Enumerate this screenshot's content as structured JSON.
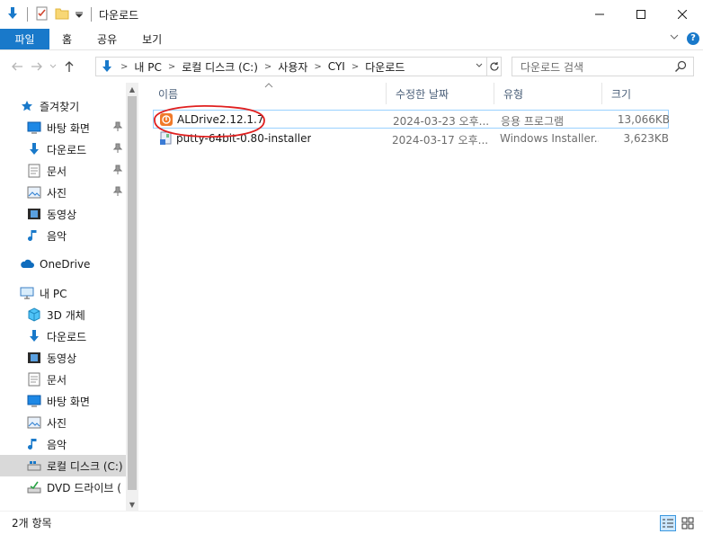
{
  "window": {
    "title": "다운로드"
  },
  "ribbon": {
    "tabs": [
      "파일",
      "홈",
      "공유",
      "보기"
    ]
  },
  "address": {
    "crumbs": [
      "내 PC",
      "로컬 디스크 (C:)",
      "사용자",
      "CYI",
      "다운로드"
    ],
    "search_placeholder": "다운로드 검색"
  },
  "sidebar": {
    "items": [
      {
        "label": "즐겨찾기",
        "icon": "star-icon",
        "pinned": false
      },
      {
        "label": "바탕 화면",
        "icon": "desktop-icon",
        "pinned": true
      },
      {
        "label": "다운로드",
        "icon": "download-icon",
        "pinned": true
      },
      {
        "label": "문서",
        "icon": "document-icon",
        "pinned": true
      },
      {
        "label": "사진",
        "icon": "pictures-icon",
        "pinned": true
      },
      {
        "label": "동영상",
        "icon": "video-icon",
        "pinned": false
      },
      {
        "label": "음악",
        "icon": "music-icon",
        "pinned": false
      },
      {
        "label": "OneDrive",
        "icon": "cloud-icon",
        "pinned": false
      },
      {
        "label": "내 PC",
        "icon": "pc-icon",
        "pinned": false
      },
      {
        "label": "3D 개체",
        "icon": "cube-icon",
        "pinned": false
      },
      {
        "label": "다운로드",
        "icon": "download-icon",
        "pinned": false
      },
      {
        "label": "동영상",
        "icon": "video-icon",
        "pinned": false
      },
      {
        "label": "문서",
        "icon": "document-icon",
        "pinned": false
      },
      {
        "label": "바탕 화면",
        "icon": "desktop-icon",
        "pinned": false
      },
      {
        "label": "사진",
        "icon": "pictures-icon",
        "pinned": false
      },
      {
        "label": "음악",
        "icon": "music-icon",
        "pinned": false
      },
      {
        "label": "로컬 디스크 (C:)",
        "icon": "drive-icon",
        "pinned": false,
        "selected": true
      },
      {
        "label": "DVD 드라이브 (",
        "icon": "dvd-icon",
        "pinned": false
      }
    ]
  },
  "columns": {
    "name": "이름",
    "modified": "수정한 날짜",
    "type": "유형",
    "size": "크기"
  },
  "files": [
    {
      "name": "ALDrive2.12.1.7",
      "modified": "2024-03-23 오후...",
      "type": "응용 프로그램",
      "size": "13,066KB",
      "icon": "aldrive-app-icon",
      "selected": true
    },
    {
      "name": "putty-64bit-0.80-installer",
      "modified": "2024-03-17 오후...",
      "type": "Windows Installer...",
      "size": "3,623KB",
      "icon": "installer-icon",
      "selected": false
    }
  ],
  "status": {
    "count": "2개 항목"
  },
  "colors": {
    "accent": "#1979ca",
    "annotation": "#e02020",
    "selection_border": "#99d1ff"
  }
}
